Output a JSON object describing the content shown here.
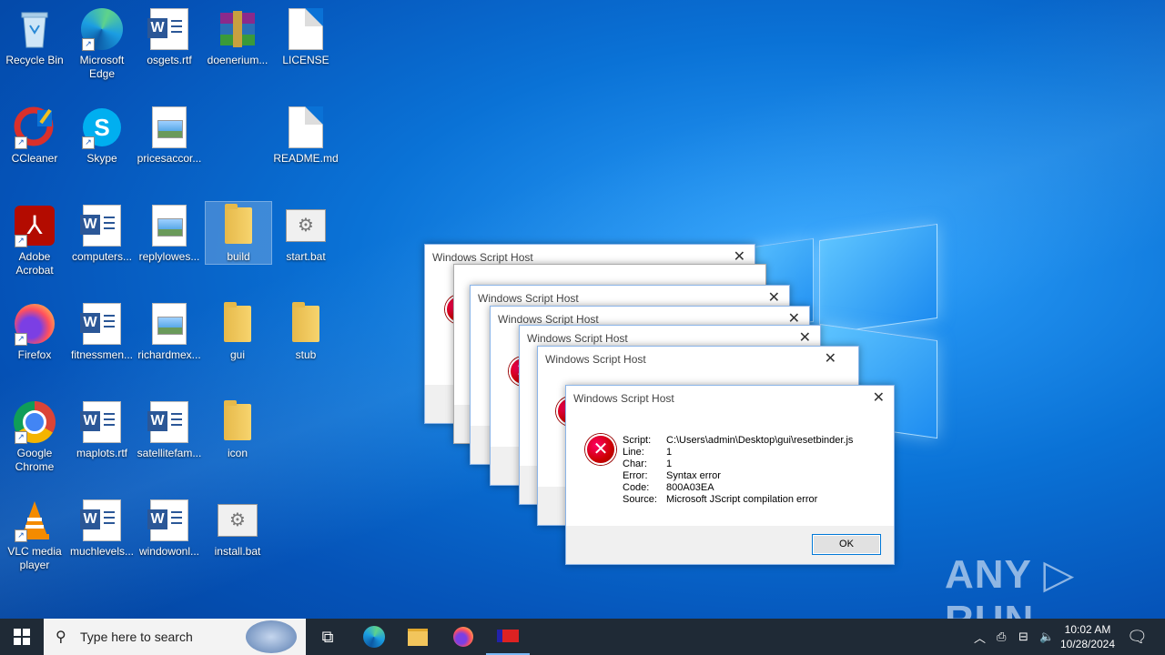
{
  "desktop": {
    "icons": [
      {
        "label": "Recycle Bin"
      },
      {
        "label": "Microsoft Edge"
      },
      {
        "label": "osgets.rtf"
      },
      {
        "label": "doenerium..."
      },
      {
        "label": "LICENSE"
      },
      {
        "label": "CCleaner"
      },
      {
        "label": "Skype"
      },
      {
        "label": "pricesaccor..."
      },
      {
        "label": "README.md"
      },
      {
        "label": "Adobe Acrobat"
      },
      {
        "label": "computers..."
      },
      {
        "label": "replylowes..."
      },
      {
        "label": "build"
      },
      {
        "label": "start.bat"
      },
      {
        "label": "Firefox"
      },
      {
        "label": "fitnessmen..."
      },
      {
        "label": "richardmex..."
      },
      {
        "label": "gui"
      },
      {
        "label": "stub"
      },
      {
        "label": "Google Chrome"
      },
      {
        "label": "maplots.rtf"
      },
      {
        "label": "satellitefam..."
      },
      {
        "label": "icon"
      },
      {
        "label": "VLC media player"
      },
      {
        "label": "muchlevels..."
      },
      {
        "label": "windowonl..."
      },
      {
        "label": "install.bat"
      }
    ]
  },
  "dialogs": {
    "title": "Windows Script Host",
    "close_glyph": "✕",
    "error_glyph": "✕",
    "front": {
      "script_key": "Script:",
      "script_val": "C:\\Users\\admin\\Desktop\\gui\\resetbinder.js",
      "line_key": "Line:",
      "line_val": "1",
      "char_key": "Char:",
      "char_val": "1",
      "error_key": "Error:",
      "error_val": "Syntax error",
      "code_key": "Code:",
      "code_val": "800A03EA",
      "source_key": "Source:",
      "source_val": "Microsoft JScript compilation error",
      "ok_label": "OK"
    }
  },
  "taskbar": {
    "search_placeholder": "Type here to search",
    "time": "10:02 AM",
    "date": "10/28/2024"
  },
  "watermark": "ANY ▷ RUN"
}
